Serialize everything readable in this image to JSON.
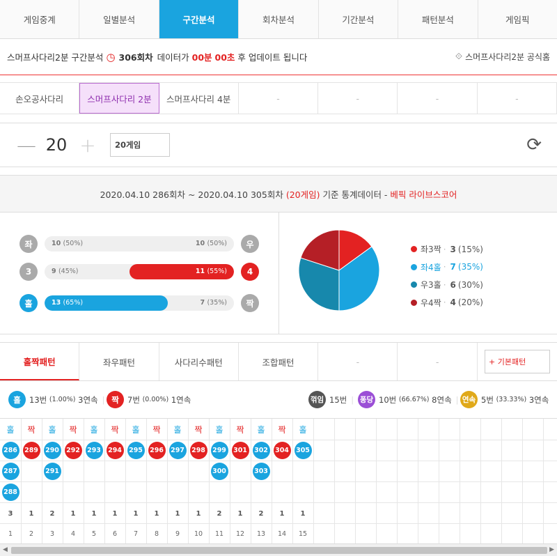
{
  "nav": {
    "tabs": [
      {
        "label": "게임중계",
        "active": false
      },
      {
        "label": "일별분석",
        "active": false
      },
      {
        "label": "구간분석",
        "active": true
      },
      {
        "label": "회차분석",
        "active": false
      },
      {
        "label": "기간분석",
        "active": false
      },
      {
        "label": "패턴분석",
        "active": false
      },
      {
        "label": "게임픽",
        "active": false
      }
    ]
  },
  "info": {
    "prefix": "스머프사다리2분 구간분석",
    "round": "306회차",
    "text1": "데이터가",
    "min": "00분",
    "sec": "00초",
    "text2": "후 업데이트 됩니다",
    "official": "스머프사다리2분 공식홈"
  },
  "games": [
    {
      "label": "손오공사다리",
      "active": false
    },
    {
      "label": "스머프사다리 2분",
      "active": true
    },
    {
      "label": "스머프사다리 4분",
      "active": false
    },
    {
      "label": "-",
      "active": false
    },
    {
      "label": "-",
      "active": false
    },
    {
      "label": "-",
      "active": false
    },
    {
      "label": "-",
      "active": false
    }
  ],
  "stepper": {
    "minus": "—",
    "value": "20",
    "plus": "+",
    "games_label": "20게임",
    "refresh": "⟳"
  },
  "statshead": {
    "range": "2020.04.10 286회차 ~ 2020.04.10 305회차",
    "count": "(20게임)",
    "mid": "기준 통계데이터 -",
    "brand": "베픽 라이브스코어"
  },
  "bars": [
    {
      "left_label": "좌",
      "right_label": "우",
      "left_color": "gray",
      "right_color": "gray",
      "left_value": "10",
      "left_pct": "(50%)",
      "right_value": "10",
      "right_pct": "(50%)",
      "left_share": 0.5,
      "fill_side": "none",
      "fill_color": ""
    },
    {
      "left_label": "3",
      "right_label": "4",
      "left_color": "gray",
      "right_color": "red",
      "left_value": "9",
      "left_pct": "(45%)",
      "right_value": "11",
      "right_pct": "(55%)",
      "left_share": 0.45,
      "fill_side": "right",
      "fill_color": "red"
    },
    {
      "left_label": "홀",
      "right_label": "짝",
      "left_color": "blue",
      "right_color": "gray",
      "left_value": "13",
      "left_pct": "(65%)",
      "right_value": "7",
      "right_pct": "(35%)",
      "left_share": 0.65,
      "fill_side": "left",
      "fill_color": "blue"
    }
  ],
  "pie": {
    "slices": [
      {
        "label": "좌3짝",
        "value": 3,
        "pct": "(15%)",
        "color": "#e32222"
      },
      {
        "label": "좌4홀",
        "value": 7,
        "pct": "(35%)",
        "color": "#1aa4df",
        "highlight": true
      },
      {
        "label": "우3홀",
        "value": 6,
        "pct": "(30%)",
        "color": "#1788ac"
      },
      {
        "label": "우4짝",
        "value": 4,
        "pct": "(20%)",
        "color": "#b51f26"
      }
    ]
  },
  "ptabs": {
    "tabs": [
      {
        "label": "홀짝패턴",
        "active": true
      },
      {
        "label": "좌우패턴",
        "active": false
      },
      {
        "label": "사다리수패턴",
        "active": false
      },
      {
        "label": "조합패턴",
        "active": false
      },
      {
        "label": "-",
        "active": false
      },
      {
        "label": "-",
        "active": false
      }
    ],
    "basic": "+ 기본패턴"
  },
  "pstats": {
    "odd": {
      "badge": "홀",
      "count": "13번",
      "pct": "(1.00%)",
      "streak": "3연속",
      "color": "#1aa4df"
    },
    "even": {
      "badge": "짝",
      "count": "7번",
      "pct": "(0.00%)",
      "streak": "1연속",
      "color": "#e32222"
    },
    "broken": {
      "badge": "꺾임",
      "count": "15번",
      "color": "#555555"
    },
    "fall": {
      "badge": "퐁당",
      "count": "10번",
      "pct": "(66.67%)",
      "streak": "8연속",
      "color": "#9b4fd6"
    },
    "cont": {
      "badge": "연속",
      "count": "5번",
      "pct": "(33.33%)",
      "streak": "3연속",
      "color": "#e0a91a"
    }
  },
  "grid": {
    "columns": [
      {
        "head": "홀",
        "color": "blue",
        "balls": [
          "286",
          "287",
          "288"
        ],
        "count": "3",
        "index": "1"
      },
      {
        "head": "짝",
        "color": "red",
        "balls": [
          "289"
        ],
        "count": "1",
        "index": "2"
      },
      {
        "head": "홀",
        "color": "blue",
        "balls": [
          "290",
          "291"
        ],
        "count": "2",
        "index": "3"
      },
      {
        "head": "짝",
        "color": "red",
        "balls": [
          "292"
        ],
        "count": "1",
        "index": "4"
      },
      {
        "head": "홀",
        "color": "blue",
        "balls": [
          "293"
        ],
        "count": "1",
        "index": "5"
      },
      {
        "head": "짝",
        "color": "red",
        "balls": [
          "294"
        ],
        "count": "1",
        "index": "6"
      },
      {
        "head": "홀",
        "color": "blue",
        "balls": [
          "295"
        ],
        "count": "1",
        "index": "7"
      },
      {
        "head": "짝",
        "color": "red",
        "balls": [
          "296"
        ],
        "count": "1",
        "index": "8"
      },
      {
        "head": "홀",
        "color": "blue",
        "balls": [
          "297"
        ],
        "count": "1",
        "index": "9"
      },
      {
        "head": "짝",
        "color": "red",
        "balls": [
          "298"
        ],
        "count": "1",
        "index": "10"
      },
      {
        "head": "홀",
        "color": "blue",
        "balls": [
          "299",
          "300"
        ],
        "count": "2",
        "index": "11"
      },
      {
        "head": "짝",
        "color": "red",
        "balls": [
          "301"
        ],
        "count": "1",
        "index": "12"
      },
      {
        "head": "홀",
        "color": "blue",
        "balls": [
          "302",
          "303"
        ],
        "count": "2",
        "index": "13"
      },
      {
        "head": "짝",
        "color": "red",
        "balls": [
          "304"
        ],
        "count": "1",
        "index": "14"
      },
      {
        "head": "홀",
        "color": "blue",
        "balls": [
          "305"
        ],
        "count": "1",
        "index": "15"
      }
    ]
  }
}
